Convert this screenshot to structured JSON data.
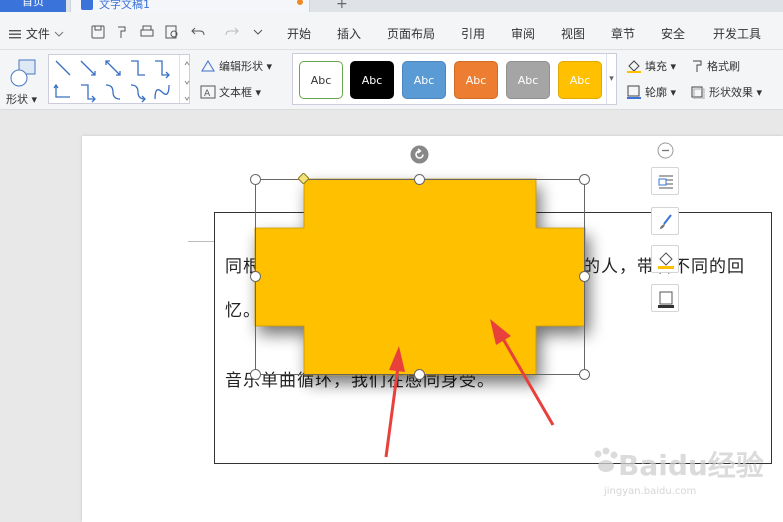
{
  "tabs": {
    "home": "首页",
    "document": "文字文稿1",
    "add": "+"
  },
  "menu": {
    "file": "文件",
    "items": [
      "开始",
      "插入",
      "页面布局",
      "引用",
      "审阅",
      "视图",
      "章节",
      "安全",
      "开发工具"
    ]
  },
  "ribbon": {
    "shape_label": "形状",
    "edit_shape": "编辑形状",
    "text_box": "文本框",
    "style_presets": [
      {
        "label": "Abc",
        "bg": "#ffffff",
        "border": "#6aa84f",
        "fg": "#333333"
      },
      {
        "label": "Abc",
        "bg": "#000000",
        "border": "#000000",
        "fg": "#ffffff"
      },
      {
        "label": "Abc",
        "bg": "#5b9bd5",
        "border": "#4a86c0",
        "fg": "#ffffff"
      },
      {
        "label": "Abc",
        "bg": "#ed7d31",
        "border": "#d46a22",
        "fg": "#ffffff"
      },
      {
        "label": "Abc",
        "bg": "#a5a5a5",
        "border": "#909090",
        "fg": "#ffffff"
      },
      {
        "label": "Abc",
        "bg": "#ffc000",
        "border": "#e0a800",
        "fg": "#ffffff"
      }
    ],
    "fill": "填充",
    "format_painter": "格式刷",
    "outline": "轮廓",
    "shape_effects": "形状效果"
  },
  "document": {
    "para1_line1_start": "同根",
    "para1_line1_end": "的人，带着不同的回",
    "para1_line2": "忆。",
    "para2": "音乐单曲循环，我们在感同身受。"
  },
  "colors": {
    "shape_fill": "#ffc000",
    "arrow": "#e8403a",
    "accent": "#3a73d9"
  },
  "watermark": {
    "brand": "Baidu经验",
    "url": "jingyan.baidu.com"
  }
}
